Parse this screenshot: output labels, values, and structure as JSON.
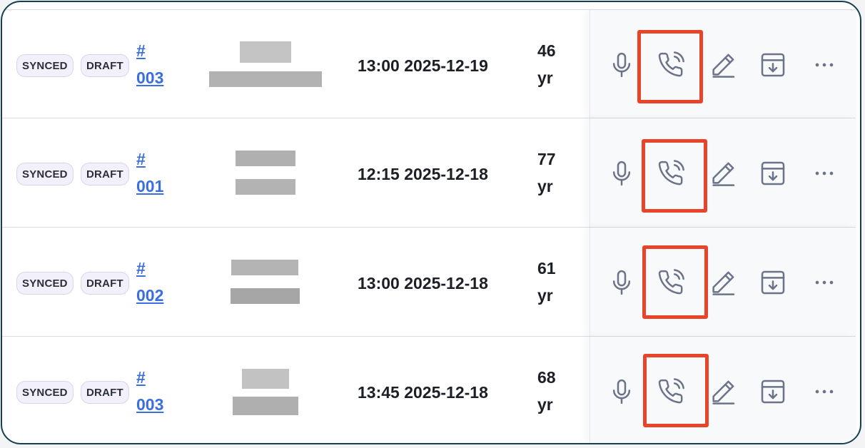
{
  "colors": {
    "border": "#163f52",
    "link": "#3b6fe0",
    "highlight": "#e8442a",
    "icon": "#6b7389"
  },
  "icons": {
    "record": "microphone-icon",
    "call": "phone-call-icon",
    "edit": "pencil-icon",
    "archive": "archive-download-icon",
    "more": "more-horizontal-icon"
  },
  "rows": [
    {
      "synced": "SYNCED",
      "draft": "DRAFT",
      "id_hash": "#",
      "id_num": "003",
      "datetime": "13:00 2025-12-19",
      "age_num": "46",
      "age_unit": "yr"
    },
    {
      "synced": "SYNCED",
      "draft": "DRAFT",
      "id_hash": "#",
      "id_num": "001",
      "datetime": "12:15 2025-12-18",
      "age_num": "77",
      "age_unit": "yr"
    },
    {
      "synced": "SYNCED",
      "draft": "DRAFT",
      "id_hash": "#",
      "id_num": "002",
      "datetime": "13:00 2025-12-18",
      "age_num": "61",
      "age_unit": "yr"
    },
    {
      "synced": "SYNCED",
      "draft": "DRAFT",
      "id_hash": "#",
      "id_num": "003",
      "datetime": "13:45 2025-12-18",
      "age_num": "68",
      "age_unit": "yr"
    }
  ]
}
